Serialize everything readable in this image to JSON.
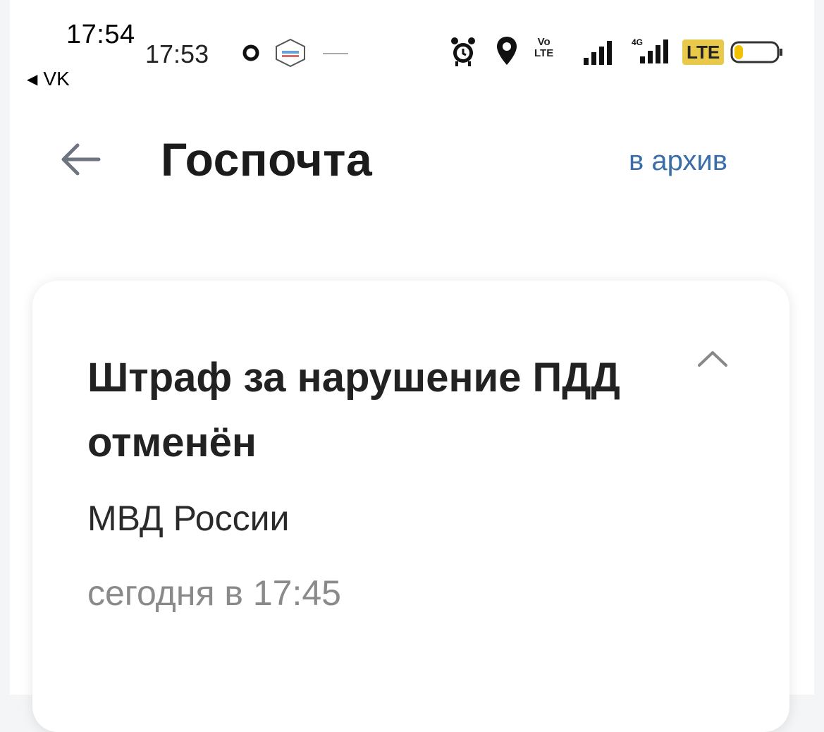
{
  "status_outer": {
    "time": "17:54",
    "back_app": "VK"
  },
  "status_inner": {
    "time": "17:53",
    "network_label": "LTE",
    "volte_top": "Vo",
    "volte_bottom": "LTE",
    "battery_level": 0.2,
    "icons": [
      "ring-icon",
      "gosuslugi-icon",
      "alarm-icon",
      "location-pin-icon",
      "volte-icon",
      "signal-icon",
      "signal-4g-icon",
      "battery-icon"
    ]
  },
  "header": {
    "title": "Госпочта",
    "archive_label": "в архив"
  },
  "message": {
    "title": "Штраф за нарушение ПДД отменён",
    "sender": "МВД России",
    "date": "сегодня в 17:45"
  },
  "colors": {
    "accent_link": "#3a6ea8",
    "lte_badge": "#e8c94a",
    "date_gray": "#8a8a8a"
  }
}
